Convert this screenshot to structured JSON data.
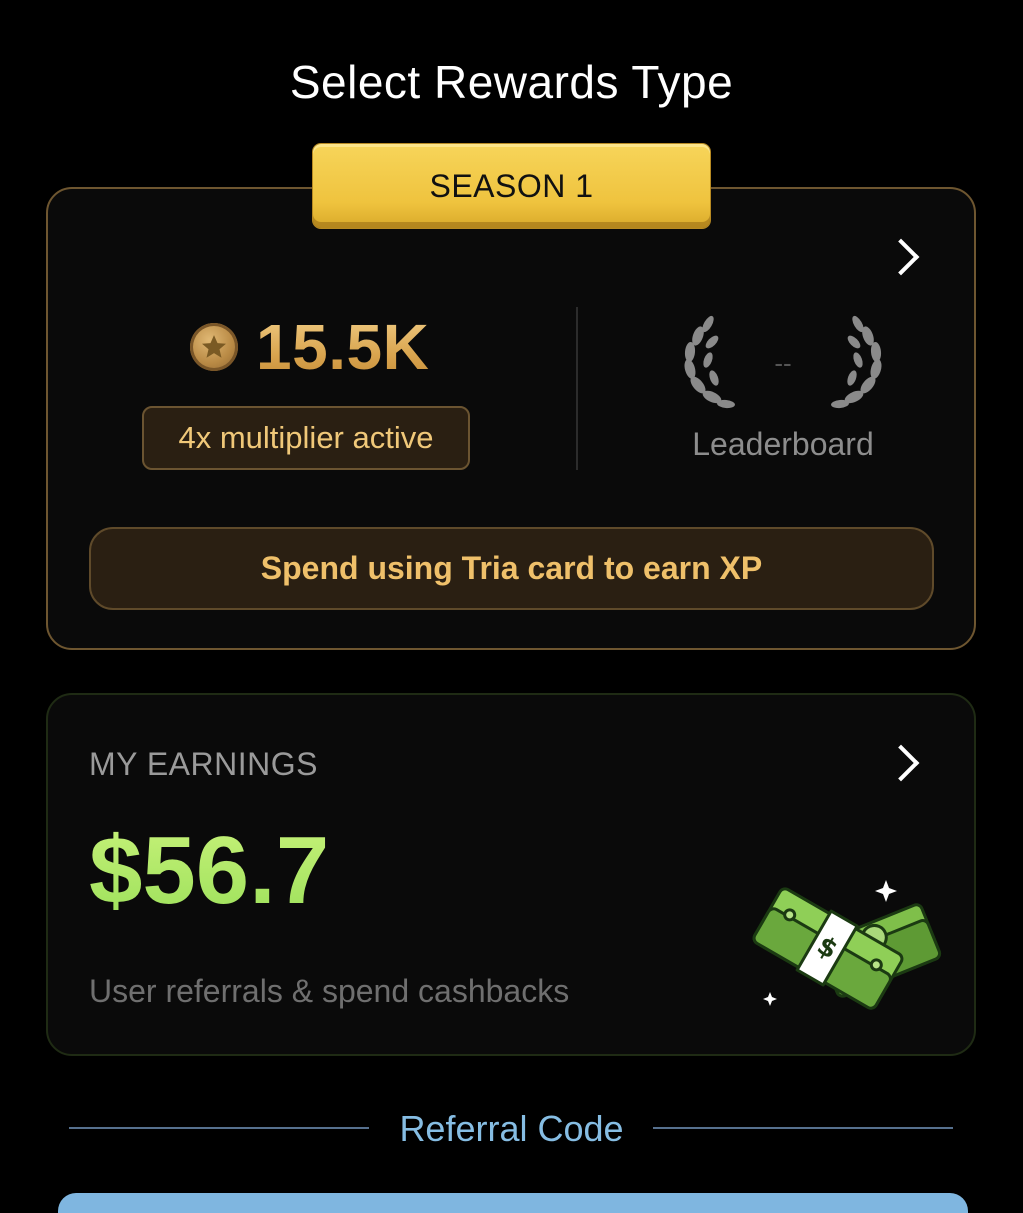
{
  "header": {
    "title": "Select Rewards Type"
  },
  "season_card": {
    "badge": "SEASON 1",
    "xp_value": "15.5K",
    "multiplier": "4x multiplier active",
    "rank": "--",
    "leaderboard_label": "Leaderboard",
    "cta": "Spend using Tria card to earn XP",
    "colors": {
      "gold": "#efc06a",
      "border": "#6e5630"
    }
  },
  "earnings_card": {
    "title": "MY EARNINGS",
    "amount": "$56.7",
    "subtitle": "User referrals & spend cashbacks",
    "colors": {
      "amount": "#a6e861"
    }
  },
  "referral": {
    "label": "Referral Code"
  },
  "icons": [
    "chevron-right-icon",
    "coin-star-icon",
    "laurel-wreath-icon",
    "money-stack-icon"
  ]
}
